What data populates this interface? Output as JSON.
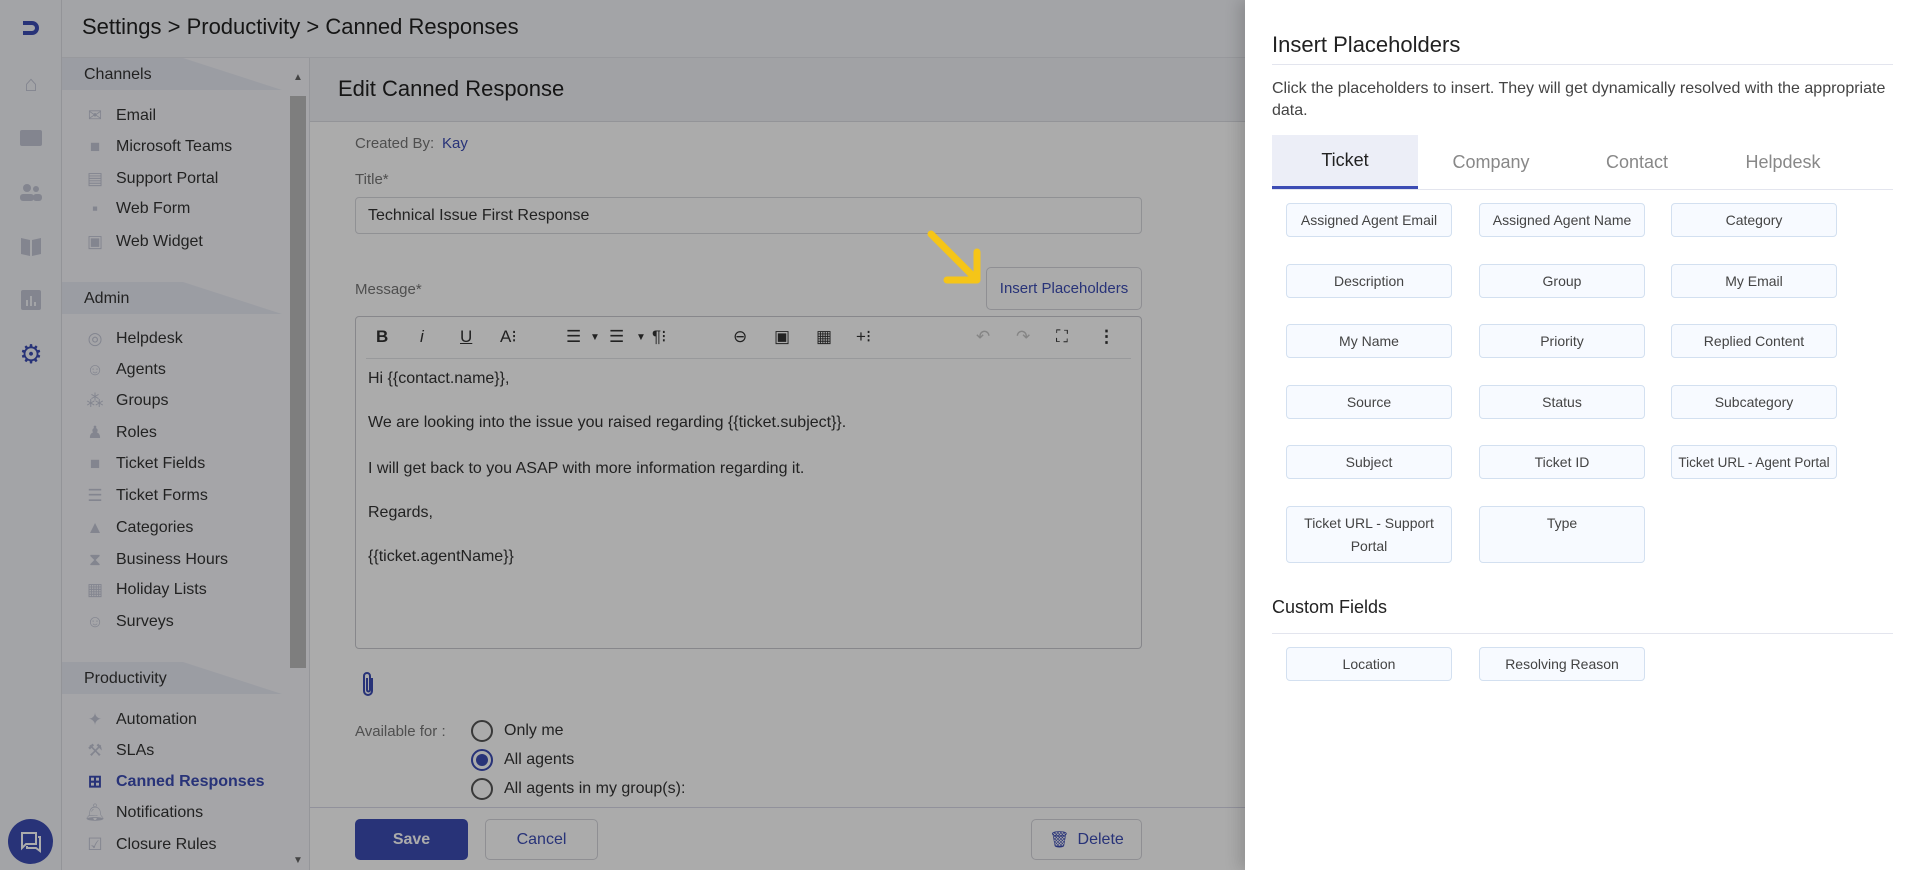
{
  "header": {
    "breadcrumb": "Settings > Productivity > Canned Responses"
  },
  "rail": {
    "icons": [
      "logo-icon",
      "home-icon",
      "ticket-icon",
      "contacts-icon",
      "knowledge-base-icon",
      "reports-icon",
      "settings-icon",
      "chat-icon"
    ]
  },
  "sidebar": {
    "sections": [
      {
        "title": "Channels",
        "items": [
          {
            "label": "Email"
          },
          {
            "label": "Microsoft Teams"
          },
          {
            "label": "Support Portal"
          },
          {
            "label": "Web Form"
          },
          {
            "label": "Web Widget"
          }
        ]
      },
      {
        "title": "Admin",
        "items": [
          {
            "label": "Helpdesk"
          },
          {
            "label": "Agents"
          },
          {
            "label": "Groups"
          },
          {
            "label": "Roles"
          },
          {
            "label": "Ticket Fields"
          },
          {
            "label": "Ticket Forms"
          },
          {
            "label": "Categories"
          },
          {
            "label": "Business Hours"
          },
          {
            "label": "Holiday Lists"
          },
          {
            "label": "Surveys"
          }
        ]
      },
      {
        "title": "Productivity",
        "items": [
          {
            "label": "Automation"
          },
          {
            "label": "SLAs"
          },
          {
            "label": "Canned Responses"
          },
          {
            "label": "Notifications"
          },
          {
            "label": "Closure Rules"
          }
        ]
      }
    ],
    "active": "Canned Responses"
  },
  "main": {
    "title": "Edit Canned Response",
    "created_by_label": "Created By:",
    "created_by": "Kay",
    "title_label": "Title*",
    "title_value": "Technical Issue First Response",
    "message_label": "Message*",
    "insert_placeholders": "Insert Placeholders",
    "toolbar": {
      "bold": "B",
      "italic": "i",
      "underline": "U",
      "font": "A⁝",
      "ol": "☰",
      "ul": "☰",
      "para": "¶⁝",
      "more": "⋮",
      "insert": "+⁝"
    },
    "message_lines": [
      "Hi {{contact.name}},",
      "We are looking into the issue you raised regarding {{ticket.subject}}.",
      "I will get back to you ASAP with more information regarding it.",
      "Regards,",
      "{{ticket.agentName}}"
    ],
    "available_for_label": "Available for :",
    "available_options": [
      "Only me",
      "All agents",
      "All agents in my group(s):"
    ],
    "available_selected": "All agents",
    "save": "Save",
    "cancel": "Cancel",
    "delete": "Delete"
  },
  "panel": {
    "title": "Insert Placeholders",
    "description": "Click the placeholders to insert. They will get dynamically resolved with the appropriate data.",
    "tabs": [
      "Ticket",
      "Company",
      "Contact",
      "Helpdesk"
    ],
    "active_tab": "Ticket",
    "placeholders": [
      "Assigned Agent Email",
      "Assigned Agent Name",
      "Category",
      "Description",
      "Group",
      "My Email",
      "My Name",
      "Priority",
      "Replied Content",
      "Source",
      "Status",
      "Subcategory",
      "Subject",
      "Ticket ID",
      "Ticket URL - Agent Portal",
      "Ticket URL - Support Portal",
      "Type"
    ],
    "custom_fields_title": "Custom Fields",
    "custom_fields": [
      "Location",
      "Resolving Reason"
    ]
  },
  "colors": {
    "primary": "#3c4cb4",
    "arrow": "#f5c518"
  }
}
